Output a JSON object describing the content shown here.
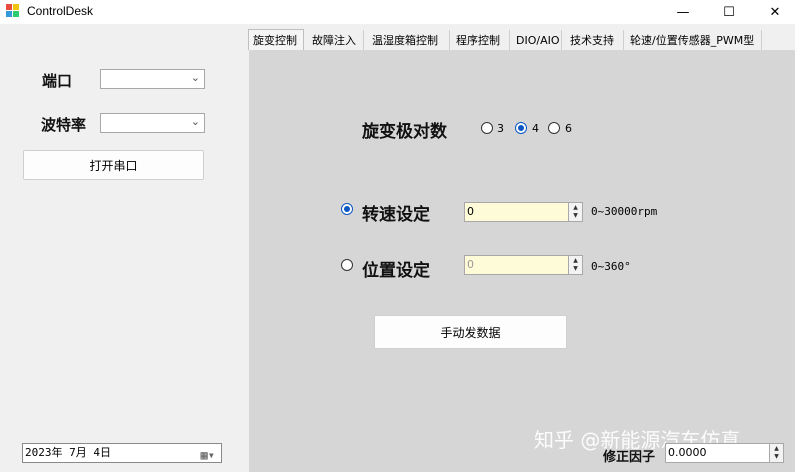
{
  "window": {
    "title": "ControlDesk",
    "controls": {
      "minimize": "—",
      "maximize": "☐",
      "close": "✕"
    }
  },
  "left_panel": {
    "port_label": "端口",
    "port_value": "",
    "baud_label": "波特率",
    "baud_value": "",
    "open_port_button": "打开串口",
    "date_value": "2023年  7月  4日"
  },
  "tabs": [
    {
      "label": "旋变控制",
      "active": true
    },
    {
      "label": "故障注入",
      "active": false
    },
    {
      "label": "温湿度箱控制",
      "active": false
    },
    {
      "label": "程序控制",
      "active": false
    },
    {
      "label": "DIO/AIO",
      "active": false
    },
    {
      "label": "技术支持",
      "active": false
    },
    {
      "label": "轮速/位置传感器_PWM型",
      "active": false
    }
  ],
  "main": {
    "pole_pairs_label": "旋变极对数",
    "pole_options": [
      {
        "label": "3",
        "checked": false
      },
      {
        "label": "4",
        "checked": true
      },
      {
        "label": "6",
        "checked": false
      }
    ],
    "speed_label": "转速设定",
    "speed_checked": true,
    "speed_value": "0",
    "speed_range": "0~30000rpm",
    "position_label": "位置设定",
    "position_checked": false,
    "position_value": "0",
    "position_range": "0~360°",
    "manual_send_button": "手动发数据",
    "correction_label": "修正因子",
    "correction_value": "0.0000"
  },
  "watermark": "知乎 @新能源汽车仿真",
  "colors": {
    "content_bg": "#d6d6d6",
    "spin_bg": "#fefbd8",
    "radio_accent": "#0a57c1"
  }
}
